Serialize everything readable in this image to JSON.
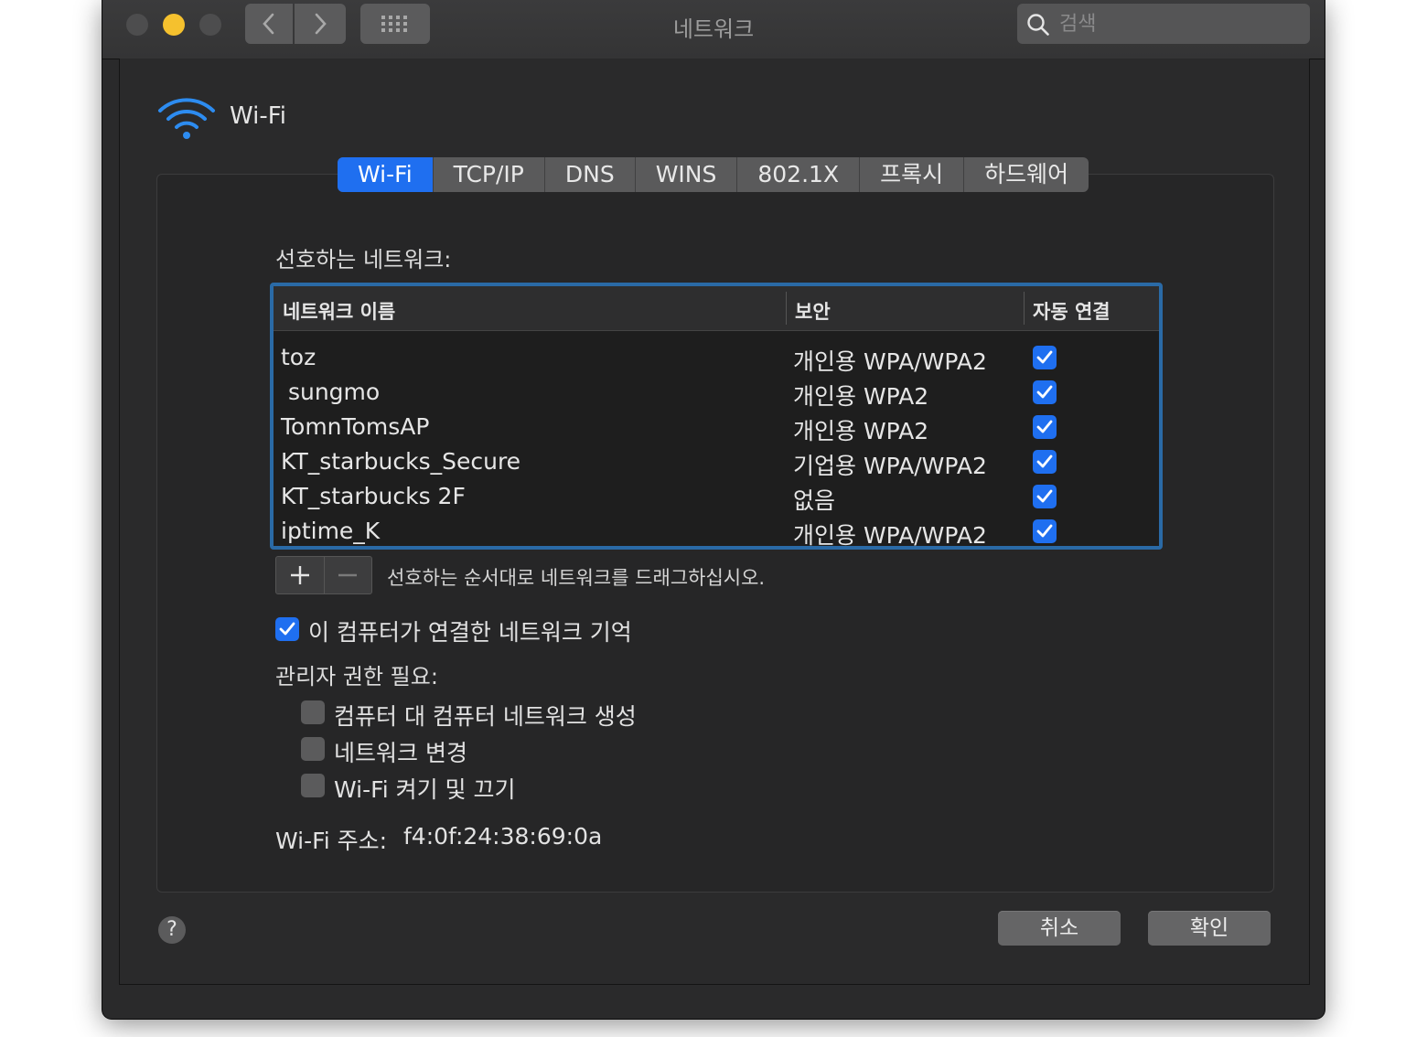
{
  "window": {
    "title": "네트워크"
  },
  "search": {
    "placeholder": "검색"
  },
  "header": {
    "label": "Wi-Fi"
  },
  "tabs": [
    "Wi-Fi",
    "TCP/IP",
    "DNS",
    "WINS",
    "802.1X",
    "프록시",
    "하드웨어"
  ],
  "active_tab": "Wi-Fi",
  "preferred": {
    "label": "선호하는 네트워크:",
    "columns": {
      "name": "네트워크 이름",
      "security": "보안",
      "auto": "자동 연결"
    },
    "rows": [
      {
        "name": "toz",
        "security": "개인용 WPA/WPA2",
        "auto": true
      },
      {
        "name": " sungmo",
        "security": "개인용 WPA2",
        "auto": true
      },
      {
        "name": "TomnTomsAP",
        "security": "개인용 WPA2",
        "auto": true
      },
      {
        "name": "KT_starbucks_Secure",
        "security": "기업용 WPA/WPA2",
        "auto": true
      },
      {
        "name": "KT_starbucks 2F",
        "security": "없음",
        "auto": true
      },
      {
        "name": "iptime_K",
        "security": "개인용 WPA/WPA2",
        "auto": true
      }
    ],
    "hint": "선호하는 순서대로 네트워크를 드래그하십시오."
  },
  "remember": {
    "label": "이 컴퓨터가 연결한 네트워크 기억",
    "checked": true
  },
  "admin": {
    "label": "관리자 권한 필요:",
    "options": [
      {
        "label": "컴퓨터 대 컴퓨터 네트워크 생성",
        "checked": false
      },
      {
        "label": "네트워크 변경",
        "checked": false
      },
      {
        "label": "Wi-Fi 켜기 및 끄기",
        "checked": false
      }
    ]
  },
  "address": {
    "label": "Wi-Fi 주소:",
    "value": "f4:0f:24:38:69:0a"
  },
  "buttons": {
    "help": "?",
    "cancel": "취소",
    "ok": "확인"
  },
  "colors": {
    "accent": "#1f6ff0",
    "window_bg": "#2a2a2b",
    "table_border": "#2a6aa6"
  }
}
